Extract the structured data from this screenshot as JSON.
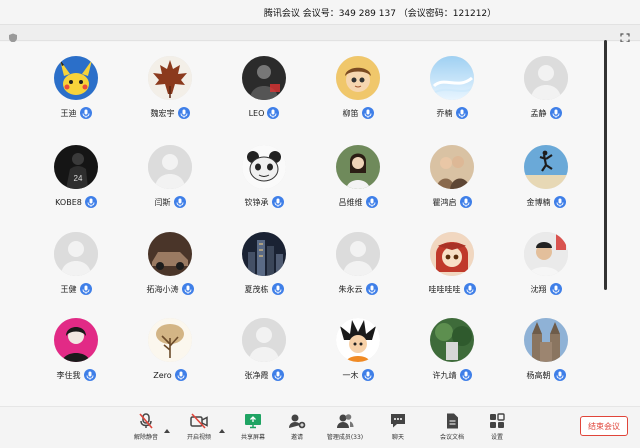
{
  "window": {
    "title": "腾讯会议  会议号：349 289 137  （会议密码：121212）"
  },
  "toolbar": {
    "shield_icon": "shield-icon",
    "fullscreen_icon": "fullscreen-icon"
  },
  "participants": [
    {
      "name": "王迪",
      "avatar": "pikachu"
    },
    {
      "name": "魏宏宇",
      "avatar": "maple-leaf"
    },
    {
      "name": "LEO",
      "avatar": "dark-photo"
    },
    {
      "name": "柳笛",
      "avatar": "cartoon-boy"
    },
    {
      "name": "乔楠",
      "avatar": "sky"
    },
    {
      "name": "孟静",
      "avatar": "default"
    },
    {
      "name": "KOBE8",
      "avatar": "kobe"
    },
    {
      "name": "闫斯",
      "avatar": "default"
    },
    {
      "name": "钦铮承",
      "avatar": "panda-meme"
    },
    {
      "name": "吕维维",
      "avatar": "girl-photo"
    },
    {
      "name": "瞿鸿启",
      "avatar": "couple-photo"
    },
    {
      "name": "金博楠",
      "avatar": "beach-jump"
    },
    {
      "name": "王健",
      "avatar": "default"
    },
    {
      "name": "拓海小涛",
      "avatar": "car-photo"
    },
    {
      "name": "夏茂栋",
      "avatar": "city-night"
    },
    {
      "name": "朱永云",
      "avatar": "default"
    },
    {
      "name": "哇哇哇哇",
      "avatar": "anime-girl"
    },
    {
      "name": "沈翔",
      "avatar": "man-photo"
    },
    {
      "name": "李住我",
      "avatar": "pink-woman"
    },
    {
      "name": "Zero",
      "avatar": "tree"
    },
    {
      "name": "张净霞",
      "avatar": "default"
    },
    {
      "name": "一木",
      "avatar": "goku"
    },
    {
      "name": "许九靖",
      "avatar": "green-photo"
    },
    {
      "name": "杨高朝",
      "avatar": "cathedral"
    }
  ],
  "bottombar": {
    "buttons": [
      {
        "label": "解除静音",
        "icon": "mic-muted-icon"
      },
      {
        "label": "开启视频",
        "icon": "video-off-icon"
      },
      {
        "label": "共享屏幕",
        "icon": "share-screen-icon"
      },
      {
        "label": "邀请",
        "icon": "invite-icon"
      },
      {
        "label": "管理成员(33)",
        "icon": "members-icon"
      },
      {
        "label": "聊天",
        "icon": "chat-icon"
      },
      {
        "label": "会议文档",
        "icon": "document-icon"
      },
      {
        "label": "设置",
        "icon": "settings-icon"
      }
    ],
    "end_label": "结束会议"
  },
  "colors": {
    "accent": "#3f7fe8",
    "danger": "#e0453a",
    "share_green": "#1fa463"
  }
}
